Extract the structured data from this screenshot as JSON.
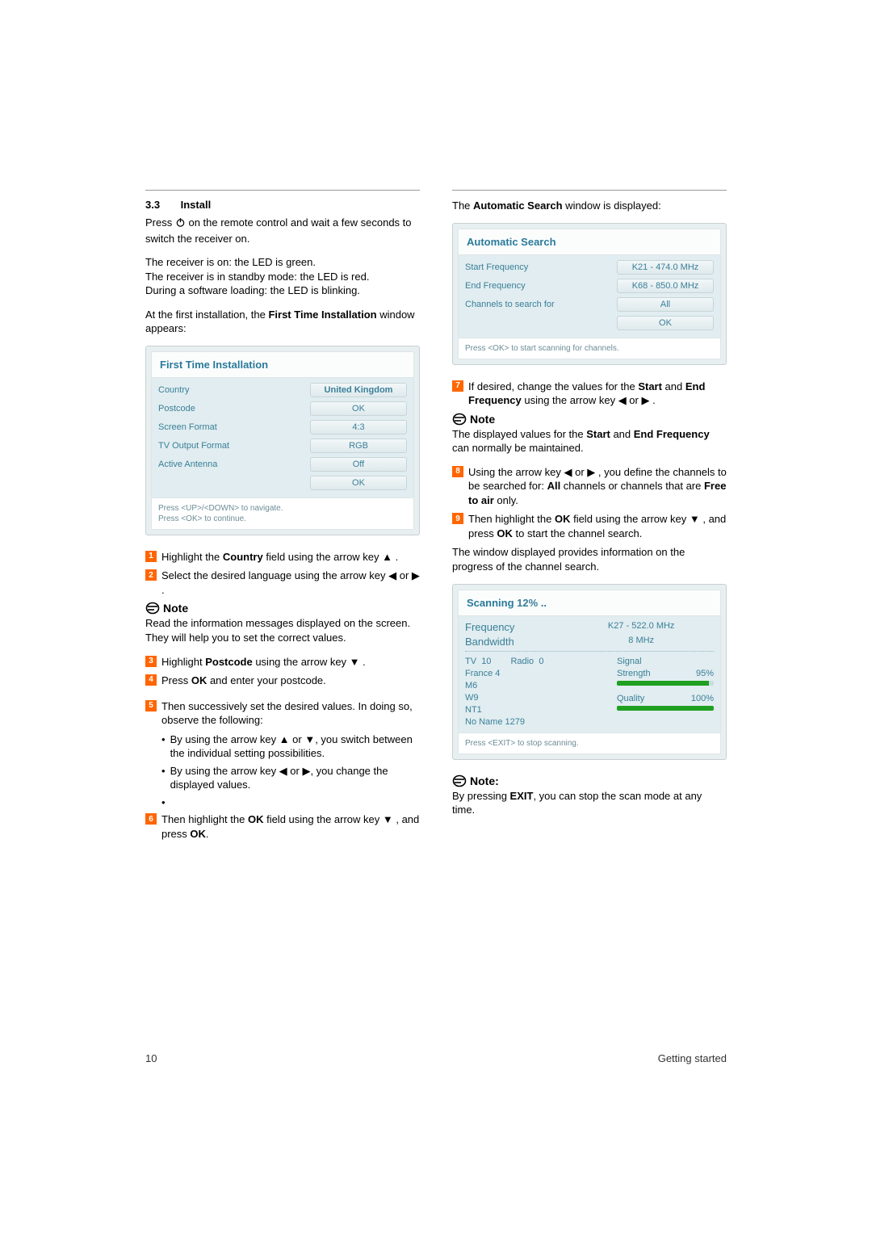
{
  "section": {
    "num": "3.3",
    "title": "Install"
  },
  "intro": {
    "p1a": "Press ",
    "p1b": " on the remote control and wait a few seconds to switch the receiver on.",
    "p2": "The receiver is on: the LED is green.",
    "p3": "The receiver is in standby mode: the LED is red.",
    "p4": "During a software loading: the LED is blinking.",
    "p5a": "At the first installation, the ",
    "p5b": "First Time Installation",
    "p5c": " window appears:"
  },
  "panel1": {
    "title": "First Time Installation",
    "rows": [
      {
        "label": "Country",
        "value": "United Kingdom",
        "strong": true
      },
      {
        "label": "Postcode",
        "value": "OK"
      },
      {
        "label": "Screen Format",
        "value": "4:3"
      },
      {
        "label": "TV Output Format",
        "value": "RGB"
      },
      {
        "label": "Active Antenna",
        "value": "Off"
      },
      {
        "label": "",
        "value": "OK"
      }
    ],
    "hint1": "Press <UP>/<DOWN> to navigate.",
    "hint2": "Press <OK> to continue."
  },
  "steps1": [
    {
      "n": "1",
      "a": "Highlight the ",
      "b": "Country",
      "c": " field using the arrow key ▲ ."
    },
    {
      "n": "2",
      "a": "Select the desired language using the arrow key ◀ or ▶ .",
      "b": "",
      "c": ""
    }
  ],
  "notes1": {
    "head": "Note",
    "body": "Read the information messages displayed on the screen. They will help you to set the correct values."
  },
  "steps2": [
    {
      "n": "3",
      "a": "Highlight ",
      "b": "Postcode",
      "c": " using the arrow key ▼ ."
    },
    {
      "n": "4",
      "a": "Press ",
      "b": "OK",
      "c": " and enter your postcode."
    },
    {
      "n": "5",
      "a": "Then successively set the desired values. In doing so, observe the following:",
      "b": "",
      "c": ""
    }
  ],
  "bullets": [
    "By using the arrow key ▲ or ▼, you switch between the individual setting possibilities.",
    "By using the arrow key ◀ or ▶, you change the displayed values."
  ],
  "steps3": [
    {
      "n": "6",
      "a": "Then highlight the ",
      "b": "OK",
      "c": " field using the arrow key ▼ , and press ",
      "d": "OK",
      "e": "."
    }
  ],
  "right": {
    "p1a": "The ",
    "p1b": "Automatic Search",
    "p1c": " window is displayed:"
  },
  "panel2": {
    "title": "Automatic Search",
    "rows": [
      {
        "label": "Start Frequency",
        "value": "K21 - 474.0 MHz"
      },
      {
        "label": "End Frequency",
        "value": "K68 - 850.0 MHz"
      },
      {
        "label": "Channels to search for",
        "value": "All"
      },
      {
        "label": "",
        "value": "OK"
      }
    ],
    "hint": "Press <OK> to start scanning for channels."
  },
  "steps4": [
    {
      "n": "7",
      "a": "If desired, change the values for the ",
      "b": "Start",
      "c": " and ",
      "d": "End Frequency",
      "e": " using the arrow key ◀ or ▶ ."
    }
  ],
  "notes2": {
    "head": "Note",
    "a": "The displayed values for the ",
    "b": "Start",
    "c": " and ",
    "d": "End Frequency",
    "e": " can normally be maintained."
  },
  "steps5": [
    {
      "n": "8",
      "a": "Using the arrow key ◀ or ▶ , you define the channels to be searched for: ",
      "b": "All",
      "c": " channels or channels that are ",
      "d": "Free to air",
      "e": " only."
    },
    {
      "n": "9",
      "a": "Then highlight the ",
      "b": "OK",
      "c": " field using the arrow key ▼ , and press ",
      "d": "OK",
      "e": " to start the channel search."
    }
  ],
  "right2": "The window displayed provides information on the progress of the channel search.",
  "panel3": {
    "title_a": "Scanning ",
    "title_pct": "12%",
    "title_b": " ..",
    "freq_label": "Frequency",
    "freq_val": "K27 - 522.0 MHz",
    "bw_label": "Bandwidth",
    "bw_val": "8 MHz",
    "tv_label": "TV",
    "tv_val": "10",
    "radio_label": "Radio",
    "radio_val": "0",
    "signal": "Signal",
    "strength_label": "Strength",
    "strength_val": "95%",
    "quality_label": "Quality",
    "quality_val": "100%",
    "channels": [
      "France 4",
      "M6",
      "W9",
      "NT1",
      "No Name 1279"
    ],
    "hint": "Press <EXIT> to stop scanning."
  },
  "chart_data": {
    "type": "bar",
    "series": [
      {
        "name": "Strength",
        "values": [
          95
        ]
      },
      {
        "name": "Quality",
        "values": [
          100
        ]
      }
    ],
    "ylim": [
      0,
      100
    ]
  },
  "notes3": {
    "head": "Note:",
    "a": "By pressing ",
    "b": "EXIT",
    "c": ", you can stop the scan mode at any time."
  },
  "footer": {
    "left": "10",
    "right": "Getting started"
  }
}
